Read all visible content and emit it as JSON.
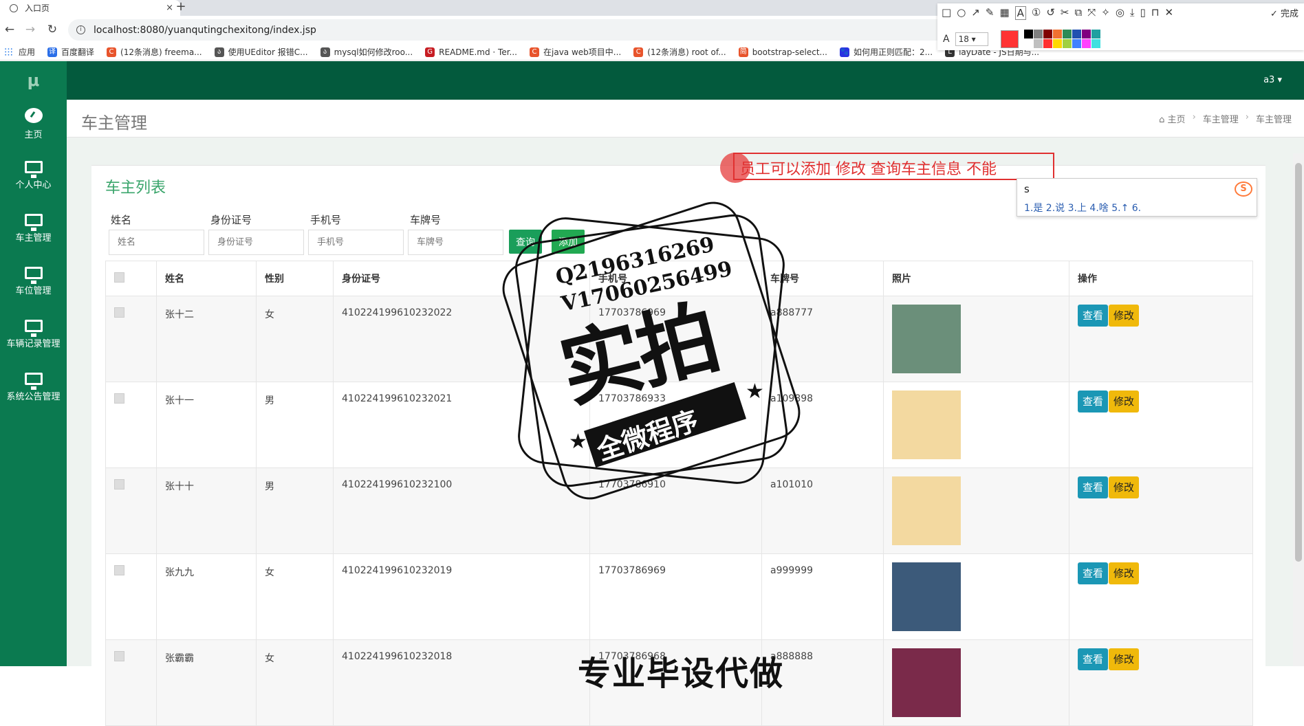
{
  "browser": {
    "tab_title": "入口页",
    "tab_close": "×",
    "new_tab": "+",
    "url": "localhost:8080/yuanqutingchexitong/index.jsp",
    "bookmarks": [
      {
        "label": "应用",
        "color": "#1a73e8",
        "glyph": ""
      },
      {
        "label": "百度翻译",
        "color": "#2a6ee8",
        "glyph": "译"
      },
      {
        "label": "(12条消息) freema...",
        "color": "#e8542c",
        "glyph": "C"
      },
      {
        "label": "使用UEditor 报错C...",
        "color": "#555555",
        "glyph": "ა"
      },
      {
        "label": "mysql如何修改roo...",
        "color": "#555555",
        "glyph": "ა"
      },
      {
        "label": "README.md · Ter...",
        "color": "#c71d23",
        "glyph": "G"
      },
      {
        "label": "在java web项目中...",
        "color": "#e8542c",
        "glyph": "C"
      },
      {
        "label": "(12条消息) root of...",
        "color": "#e8542c",
        "glyph": "C"
      },
      {
        "label": "bootstrap-select...",
        "color": "#e8542c",
        "glyph": "简"
      },
      {
        "label": "如何用正则匹配：2...",
        "color": "#2932e1",
        "glyph": "🐾"
      },
      {
        "label": "layDate - JS日期与...",
        "color": "#333333",
        "glyph": "L"
      }
    ]
  },
  "annot_toolbar": {
    "done_label": "完成",
    "font_size": "18",
    "palette": [
      "#000000",
      "#808080",
      "#800000",
      "#f07030",
      "#2e8b57",
      "#2050b0",
      "#800080",
      "#20a0a0",
      "#ffffff",
      "#c0c0c0",
      "#ff3030",
      "#ffd700",
      "#a0d040",
      "#4080ff",
      "#ff40ff",
      "#40e0e0"
    ]
  },
  "app": {
    "logo": "μ",
    "user": "a3 ▾",
    "sidebar": [
      {
        "label": "主页",
        "icon": "dashboard-icon"
      },
      {
        "label": "个人中心",
        "icon": "monitor-icon"
      },
      {
        "label": "车主管理",
        "icon": "monitor-icon"
      },
      {
        "label": "车位管理",
        "icon": "monitor-icon"
      },
      {
        "label": "车辆记录管理",
        "icon": "monitor-icon"
      },
      {
        "label": "系统公告管理",
        "icon": "monitor-icon"
      }
    ],
    "page_title": "车主管理",
    "breadcrumb": {
      "home": "主页",
      "sep": "›",
      "level1": "车主管理",
      "level2": "车主管理"
    },
    "panel_title": "车主列表",
    "filters": [
      {
        "label": "姓名",
        "placeholder": "姓名"
      },
      {
        "label": "身份证号",
        "placeholder": "身份证号"
      },
      {
        "label": "手机号",
        "placeholder": "手机号"
      },
      {
        "label": "车牌号",
        "placeholder": "车牌号"
      }
    ],
    "search_button": "查询",
    "add_button": "添加",
    "columns": [
      "姓名",
      "性别",
      "身份证号",
      "手机号",
      "车牌号",
      "照片",
      "操作"
    ],
    "view_label": "查看",
    "edit_label": "修改",
    "rows": [
      {
        "name": "张十二",
        "gender": "女",
        "id_no": "410224199610232022",
        "phone": "17703786969",
        "plate": "a888777",
        "photo": "#6b8f7a"
      },
      {
        "name": "张十一",
        "gender": "男",
        "id_no": "410224199610232021",
        "phone": "17703786933",
        "plate": "a109898",
        "photo": "#f3d9a0"
      },
      {
        "name": "张十十",
        "gender": "男",
        "id_no": "410224199610232100",
        "phone": "17703786910",
        "plate": "a101010",
        "photo": "#f3d9a0"
      },
      {
        "name": "张九九",
        "gender": "女",
        "id_no": "410224199610232019",
        "phone": "17703786969",
        "plate": "a999999",
        "photo": "#3c5a7a"
      },
      {
        "name": "张霸霸",
        "gender": "女",
        "id_no": "410224199610232018",
        "phone": "17703786968",
        "plate": "a888888",
        "photo": "#7a2a4a"
      }
    ]
  },
  "annotation": {
    "text": "员工可以添加 修改 查询车主信息 不能",
    "ime_input": "s",
    "ime_candidates": "1.是  2.说  3.上  4.啥  5.↑  6.",
    "ime_logo": "S"
  },
  "watermark": {
    "qq": "Q2196316269",
    "wechat": "V17060256499",
    "big": "实拍",
    "band": "全微程序",
    "bottom": "专业毕设代做"
  }
}
